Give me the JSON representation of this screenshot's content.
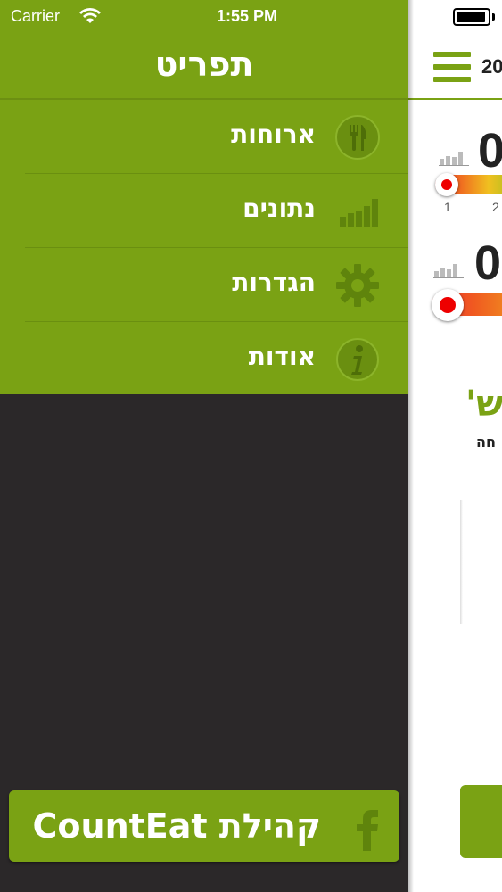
{
  "status_bar": {
    "carrier": "Carrier",
    "time": "1:55 PM"
  },
  "drawer": {
    "title": "תפריט",
    "menu": [
      {
        "label": "ארוחות",
        "icon": "fork-knife-icon"
      },
      {
        "label": "נתונים",
        "icon": "bar-chart-icon"
      },
      {
        "label": "הגדרות",
        "icon": "gear-icon"
      },
      {
        "label": "אודות",
        "icon": "info-icon"
      }
    ],
    "community_button": {
      "label": "קהילת CountEat",
      "icon": "facebook-icon"
    }
  },
  "main": {
    "date_fragment": "20",
    "value_1": "0",
    "value_2": "0",
    "scale_ticks": [
      "1",
      "2"
    ],
    "heading_fragment": "ש'",
    "sub_fragment": "חה"
  },
  "colors": {
    "accent": "#7aa214",
    "drawer_bg": "#2b2829",
    "knob": "#e00000"
  }
}
